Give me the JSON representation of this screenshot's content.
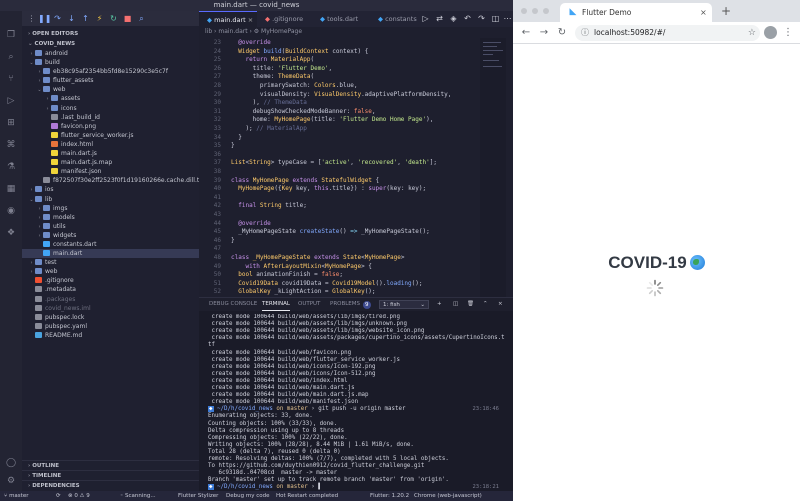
{
  "window": {
    "title": "main.dart — covid_news"
  },
  "sidebar": {
    "open_editors": "OPEN EDITORS",
    "root": "COVID_NEWS",
    "tree": [
      {
        "label": "android",
        "depth": 1,
        "type": "folder",
        "open": false
      },
      {
        "label": "build",
        "depth": 1,
        "type": "folder",
        "open": true
      },
      {
        "label": "eb38c95af2354bb5fd8e15290c3e5c7f",
        "depth": 2,
        "type": "folder",
        "open": false
      },
      {
        "label": "flutter_assets",
        "depth": 2,
        "type": "folder",
        "open": false
      },
      {
        "label": "web",
        "depth": 2,
        "type": "folder",
        "open": true
      },
      {
        "label": "assets",
        "depth": 3,
        "type": "folder",
        "open": false
      },
      {
        "label": "icons",
        "depth": 3,
        "type": "folder",
        "open": false
      },
      {
        "label": ".last_build_id",
        "depth": 3,
        "type": "file"
      },
      {
        "label": "favicon.png",
        "depth": 3,
        "type": "png"
      },
      {
        "label": "flutter_service_worker.js",
        "depth": 3,
        "type": "js"
      },
      {
        "label": "index.html",
        "depth": 3,
        "type": "html"
      },
      {
        "label": "main.dart.js",
        "depth": 3,
        "type": "js"
      },
      {
        "label": "main.dart.js.map",
        "depth": 3,
        "type": "js"
      },
      {
        "label": "manifest.json",
        "depth": 3,
        "type": "json"
      },
      {
        "label": "f872507f30e2ff2523f0f1d19160266e.cache.dill.track...",
        "depth": 2,
        "type": "file"
      },
      {
        "label": "ios",
        "depth": 1,
        "type": "folder",
        "open": false
      },
      {
        "label": "lib",
        "depth": 1,
        "type": "folder",
        "open": true
      },
      {
        "label": "imgs",
        "depth": 2,
        "type": "folder",
        "open": false
      },
      {
        "label": "models",
        "depth": 2,
        "type": "folder",
        "open": false
      },
      {
        "label": "utils",
        "depth": 2,
        "type": "folder",
        "open": false
      },
      {
        "label": "widgets",
        "depth": 2,
        "type": "folder",
        "open": false
      },
      {
        "label": "constants.dart",
        "depth": 2,
        "type": "dart"
      },
      {
        "label": "main.dart",
        "depth": 2,
        "type": "dart",
        "selected": true
      },
      {
        "label": "test",
        "depth": 1,
        "type": "folder",
        "open": false
      },
      {
        "label": "web",
        "depth": 1,
        "type": "folder",
        "open": false
      },
      {
        "label": ".gitignore",
        "depth": 1,
        "type": "git"
      },
      {
        "label": ".metadata",
        "depth": 1,
        "type": "file"
      },
      {
        "label": ".packages",
        "depth": 1,
        "type": "file",
        "dim": true
      },
      {
        "label": "covid_news.iml",
        "depth": 1,
        "type": "file",
        "dim": true
      },
      {
        "label": "pubspec.lock",
        "depth": 1,
        "type": "file"
      },
      {
        "label": "pubspec.yaml",
        "depth": 1,
        "type": "file"
      },
      {
        "label": "README.md",
        "depth": 1,
        "type": "md"
      }
    ],
    "outline": "OUTLINE",
    "timeline": "TIMELINE",
    "dependencies": "DEPENDENCIES"
  },
  "editor": {
    "tabs": [
      {
        "label": "main.dart",
        "active": true
      },
      {
        "label": ".gitignore",
        "active": false
      },
      {
        "label": "tools.dart",
        "active": false
      },
      {
        "label": "constants",
        "active": false
      }
    ],
    "breadcrumb": "lib › main.dart › ⚙ MyHomePage",
    "lines": [
      {
        "n": "23",
        "html": "  <span class='k'>@override</span>"
      },
      {
        "n": "24",
        "html": "  <span class='t'>Widget</span> <span class='f'>build</span>(<span class='t'>BuildContext</span> context) {"
      },
      {
        "n": "25",
        "html": "    <span class='k'>return</span> <span class='t'>MaterialApp</span>("
      },
      {
        "n": "26",
        "html": "      title: <span class='s'>'Flutter Demo'</span>,"
      },
      {
        "n": "27",
        "html": "      theme: <span class='t'>ThemeData</span>("
      },
      {
        "n": "28",
        "html": "        primarySwatch: <span class='t'>Colors</span>.blue,"
      },
      {
        "n": "29",
        "html": "        visualDensity: <span class='t'>VisualDensity</span>.adaptivePlatformDensity,"
      },
      {
        "n": "30",
        "html": "      ), <span class='c'>// ThemeData</span>"
      },
      {
        "n": "31",
        "html": "      debugShowCheckedModeBanner: <span class='p'>false</span>,"
      },
      {
        "n": "32",
        "html": "      home: <span class='t'>MyHomePage</span>(title: <span class='s'>'Flutter Demo Home Page'</span>),"
      },
      {
        "n": "33",
        "html": "    ); <span class='c'>// MaterialApp</span>"
      },
      {
        "n": "34",
        "html": "  }"
      },
      {
        "n": "35",
        "html": "}"
      },
      {
        "n": "36",
        "html": ""
      },
      {
        "n": "37",
        "html": "<span class='t'>List</span>&lt;<span class='t'>String</span>&gt; typeCase = [<span class='s'>'active'</span>, <span class='s'>'recovered'</span>, <span class='s'>'death'</span>];"
      },
      {
        "n": "38",
        "html": ""
      },
      {
        "n": "39",
        "html": "<span class='k'>class</span> <span class='t'>MyHomePage</span> <span class='k'>extends</span> <span class='t'>StatefulWidget</span> {"
      },
      {
        "n": "40",
        "html": "  <span class='t'>MyHomePage</span>({<span class='t'>Key</span> key, <span class='k'>this</span>.title}) : <span class='k'>super</span>(key: key);"
      },
      {
        "n": "41",
        "html": ""
      },
      {
        "n": "42",
        "html": "  <span class='k'>final</span> <span class='t'>String</span> title;"
      },
      {
        "n": "43",
        "html": ""
      },
      {
        "n": "44",
        "html": "  <span class='k'>@override</span>"
      },
      {
        "n": "45",
        "html": "  _MyHomePageState <span class='f'>createState</span>() <span class='cy'>=&gt;</span> _MyHomePageState();"
      },
      {
        "n": "46",
        "html": "}"
      },
      {
        "n": "47",
        "html": ""
      },
      {
        "n": "48",
        "html": "<span class='k'>class</span> <span class='t'>_MyHomePageState</span> <span class='k'>extends</span> <span class='t'>State</span>&lt;<span class='t'>MyHomePage</span>&gt;"
      },
      {
        "n": "49",
        "html": "    <span class='k'>with</span> <span class='t'>AfterLayoutMixin</span>&lt;<span class='t'>MyHomePage</span>&gt; {"
      },
      {
        "n": "50",
        "html": "  <span class='t'>bool</span> animationFinish = <span class='p'>false</span>;"
      },
      {
        "n": "51",
        "html": "  <span class='t'>Covid19Data</span> covid19Data = <span class='t'>Covid19Model</span>().<span class='f'>loading</span>();"
      },
      {
        "n": "52",
        "html": "  <span class='t'>GlobalKey</span> _kLightAction = <span class='t'>GlobalKey</span>();"
      }
    ]
  },
  "panel": {
    "tabs": [
      "DEBUG CONSOLE",
      "TERMINAL",
      "OUTPUT",
      "PROBLEMS"
    ],
    "problems_count": "9",
    "terminal_select": "1: fish",
    "lines": [
      {
        "text": " create mode 100644 build/web/assets/lib/imgs/tired.png"
      },
      {
        "text": " create mode 100644 build/web/assets/lib/imgs/unknown.png"
      },
      {
        "text": " create mode 100644 build/web/assets/lib/imgs/website_icon.png"
      },
      {
        "text": " create mode 100644 build/web/assets/packages/cupertino_icons/assets/CupertinoIcons.t"
      },
      {
        "text": "tf"
      },
      {
        "text": " create mode 100644 build/web/favicon.png"
      },
      {
        "text": " create mode 100644 build/web/flutter_service_worker.js"
      },
      {
        "text": " create mode 100644 build/web/icons/Icon-192.png"
      },
      {
        "text": " create mode 100644 build/web/icons/Icon-512.png"
      },
      {
        "text": " create mode 100644 build/web/index.html"
      },
      {
        "text": " create mode 100644 build/web/main.dart.js"
      },
      {
        "text": " create mode 100644 build/web/main.dart.js.map"
      },
      {
        "text": " create mode 100644 build/web/manifest.json"
      },
      {
        "prompt": true,
        "cwd": "~/D/h/covid_news",
        "branch": " on master",
        "cmd": " › git push -u origin master",
        "time": "23:18:46"
      },
      {
        "text": "Enumerating objects: 33, done."
      },
      {
        "text": "Counting objects: 100% (33/33), done."
      },
      {
        "text": "Delta compression using up to 8 threads"
      },
      {
        "text": "Compressing objects: 100% (22/22), done."
      },
      {
        "text": "Writing objects: 100% (28/28), 8.44 MiB | 1.61 MiB/s, done."
      },
      {
        "text": "Total 28 (delta 7), reused 0 (delta 0)"
      },
      {
        "text": "remote: Resolving deltas: 100% (7/7), completed with 5 local objects."
      },
      {
        "text": "To https://github.com/duythien0912/covid_flutter_challenge.git"
      },
      {
        "text": "   6c9318d..04708cd  master -> master"
      },
      {
        "text": "Branch 'master' set up to track remote branch 'master' from 'origin'."
      },
      {
        "prompt": true,
        "cwd": "~/D/h/covid_news",
        "branch": " on master",
        "cmd": " › ▌",
        "time": "23:18:21"
      }
    ]
  },
  "statusbar": {
    "branch": "master",
    "sync": "⟳",
    "problems": "⊗ 0 ⚠ 9",
    "scanning": "◦ Scanning...",
    "stylizer": "Flutter Stylizer",
    "debug": "Debug my code",
    "hot_restart": "Hot Restart completed",
    "flutter": "Flutter: 1.20.2",
    "device": "Chrome (web-javascript)"
  },
  "browser": {
    "tab_title": "Flutter Demo",
    "url": "localhost:50982/#/",
    "headline": "COVID-19"
  }
}
